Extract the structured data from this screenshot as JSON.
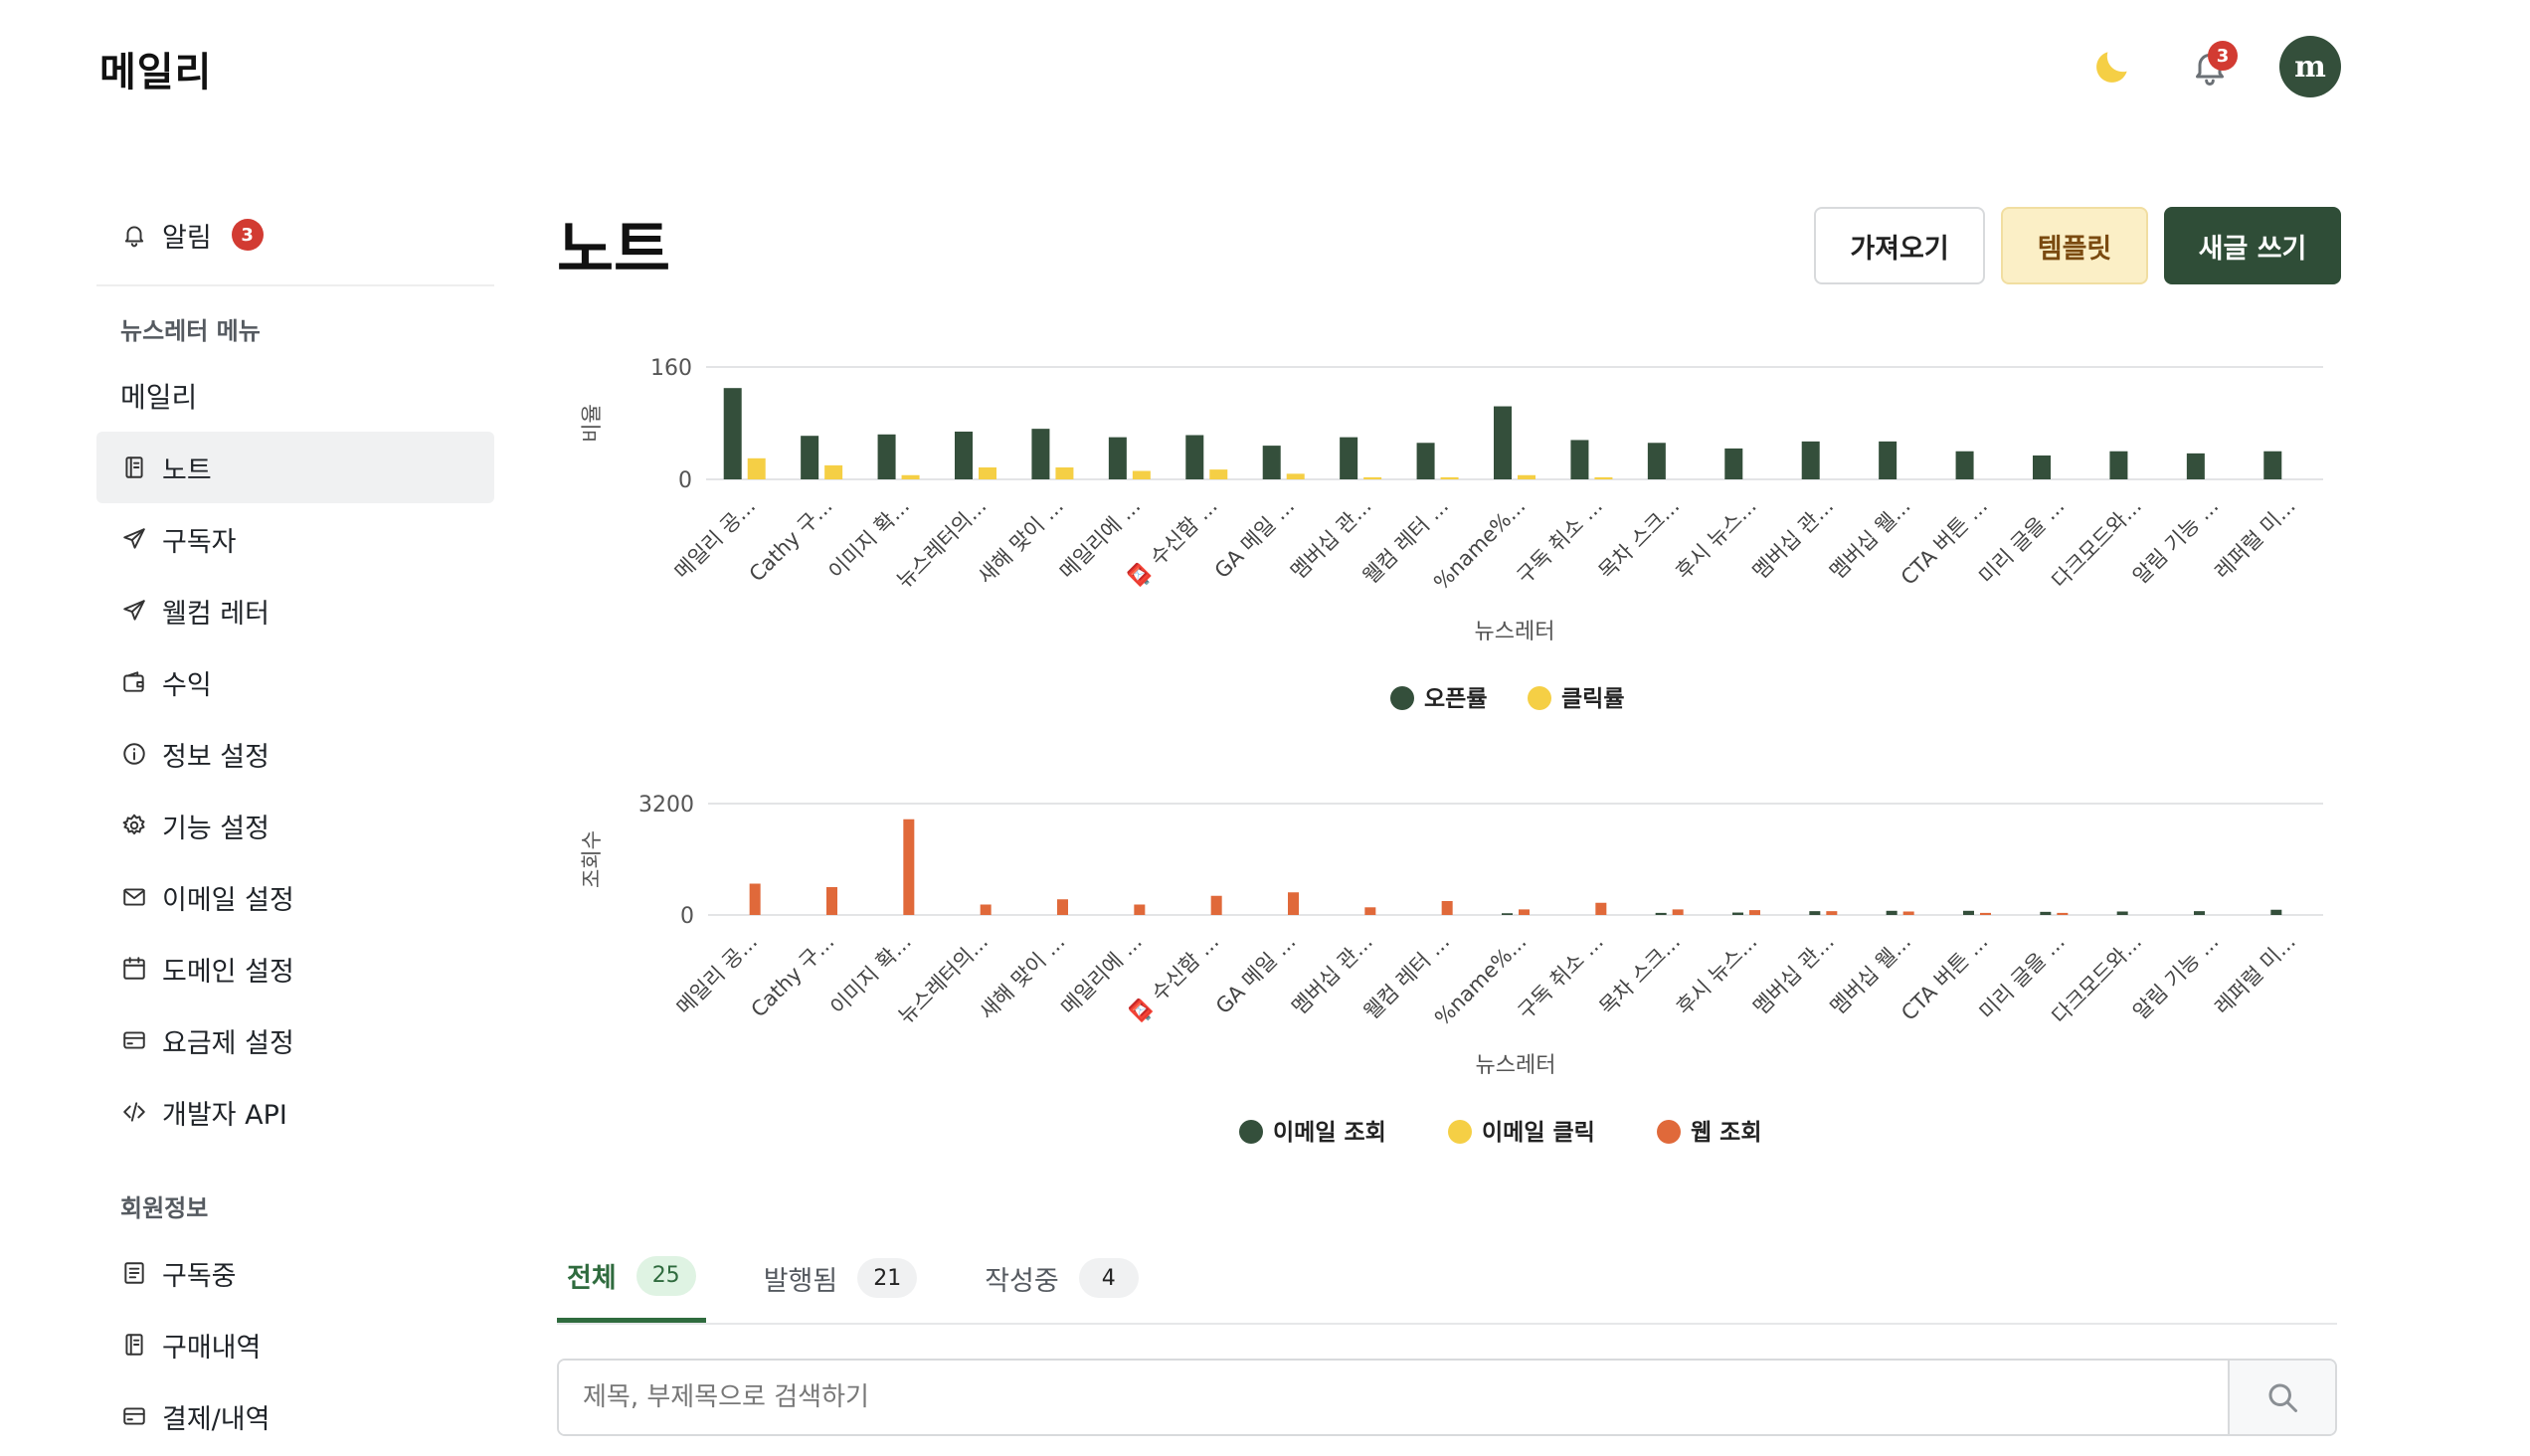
{
  "app": {
    "logo": "메일리"
  },
  "header": {
    "notification_count": "3",
    "avatar_text": "m",
    "theme_icon": "moon-icon"
  },
  "sidebar": {
    "alert": {
      "label": "알림",
      "badge": "3"
    },
    "section_newsletter": "뉴스레터 메뉴",
    "newsletter_name": "메일리",
    "items": [
      {
        "label": "노트",
        "icon": "notebook-icon",
        "active": true
      },
      {
        "label": "구독자",
        "icon": "send-icon"
      },
      {
        "label": "웰컴 레터",
        "icon": "send-icon"
      },
      {
        "label": "수익",
        "icon": "wallet-icon"
      },
      {
        "label": "정보 설정",
        "icon": "info-icon"
      },
      {
        "label": "기능 설정",
        "icon": "gear-icon"
      },
      {
        "label": "이메일 설정",
        "icon": "mail-icon"
      },
      {
        "label": "도메인 설정",
        "icon": "calendar-icon"
      },
      {
        "label": "요금제 설정",
        "icon": "card-icon"
      },
      {
        "label": "개발자 API",
        "icon": "code-icon"
      }
    ],
    "section_member": "회원정보",
    "member_items": [
      {
        "label": "구독중",
        "icon": "list-icon"
      },
      {
        "label": "구매내역",
        "icon": "notebook-icon"
      },
      {
        "label": "결제/내역",
        "icon": "card-icon"
      }
    ]
  },
  "main": {
    "title": "노트",
    "buttons": {
      "import": "가져오기",
      "template": "템플릿",
      "new_post": "새글 쓰기"
    }
  },
  "colors": {
    "green": "#344f3b",
    "yellow": "#f5cf45",
    "orange": "#e0693a"
  },
  "chart_data": [
    {
      "type": "bar",
      "xlabel": "뉴스레터",
      "ylabel": "비율",
      "ylim": [
        0,
        160
      ],
      "yticks": [
        0,
        160
      ],
      "grid": true,
      "legend_position": "bottom",
      "categories": [
        "메일리 공...",
        "Cathy 구...",
        "이미지 확...",
        "뉴스레터의...",
        "새해 맞이 ...",
        "메일리에 ...",
        "📮 수신함 ...",
        "GA 메일 ...",
        "멤버십 관...",
        "웰컴 레터 ...",
        "%name%...",
        "구독 취소 ...",
        "목차 스크...",
        "후시 뉴스...",
        "멤버십 관...",
        "멤버십 웰...",
        "CTA 버튼 ...",
        "미리 글을 ...",
        "다크모드와...",
        "알림 기능 ...",
        "레퍼럴 미..."
      ],
      "series": [
        {
          "name": "오픈률",
          "color": "#344f3b",
          "values": [
            130,
            62,
            64,
            68,
            72,
            60,
            63,
            48,
            60,
            52,
            104,
            56,
            52,
            44,
            54,
            54,
            40,
            34,
            40,
            37,
            40
          ]
        },
        {
          "name": "클릭률",
          "color": "#f5cf45",
          "values": [
            30,
            20,
            6,
            17,
            17,
            12,
            14,
            8,
            3,
            3,
            6,
            3,
            0,
            0,
            0,
            0,
            0,
            0,
            0,
            0,
            0
          ]
        }
      ]
    },
    {
      "type": "bar",
      "xlabel": "뉴스레터",
      "ylabel": "조회수",
      "ylim": [
        0,
        3200
      ],
      "yticks": [
        0,
        3200
      ],
      "grid": true,
      "legend_position": "bottom",
      "categories": [
        "메일리 공...",
        "Cathy 구...",
        "이미지 확...",
        "뉴스레터의...",
        "새해 맞이 ...",
        "메일리에 ...",
        "📮 수신함 ...",
        "GA 메일 ...",
        "멤버십 관...",
        "웰컴 레터 ...",
        "%name%...",
        "구독 취소 ...",
        "목차 스크...",
        "후시 뉴스...",
        "멤버십 관...",
        "멤버십 웰...",
        "CTA 버튼 ...",
        "미리 글을 ...",
        "다크모드와...",
        "알림 기능 ...",
        "레퍼럴 미..."
      ],
      "series": [
        {
          "name": "이메일 조회",
          "color": "#344f3b",
          "values": [
            0,
            0,
            0,
            0,
            0,
            0,
            0,
            0,
            0,
            0,
            50,
            0,
            60,
            70,
            110,
            120,
            120,
            90,
            100,
            110,
            150
          ]
        },
        {
          "name": "이메일 클릭",
          "color": "#f5cf45",
          "values": [
            0,
            0,
            0,
            0,
            0,
            0,
            0,
            0,
            0,
            0,
            0,
            0,
            0,
            0,
            0,
            0,
            0,
            0,
            0,
            0,
            0
          ]
        },
        {
          "name": "웹 조회",
          "color": "#e0693a",
          "values": [
            900,
            800,
            2750,
            300,
            450,
            300,
            550,
            650,
            220,
            400,
            160,
            350,
            160,
            140,
            110,
            100,
            60,
            60,
            0,
            0,
            0
          ]
        }
      ]
    }
  ],
  "tabs": [
    {
      "label": "전체",
      "count": "25",
      "active": true
    },
    {
      "label": "발행됨",
      "count": "21"
    },
    {
      "label": "작성중",
      "count": "4"
    }
  ],
  "search": {
    "placeholder": "제목, 부제목으로 검색하기"
  }
}
